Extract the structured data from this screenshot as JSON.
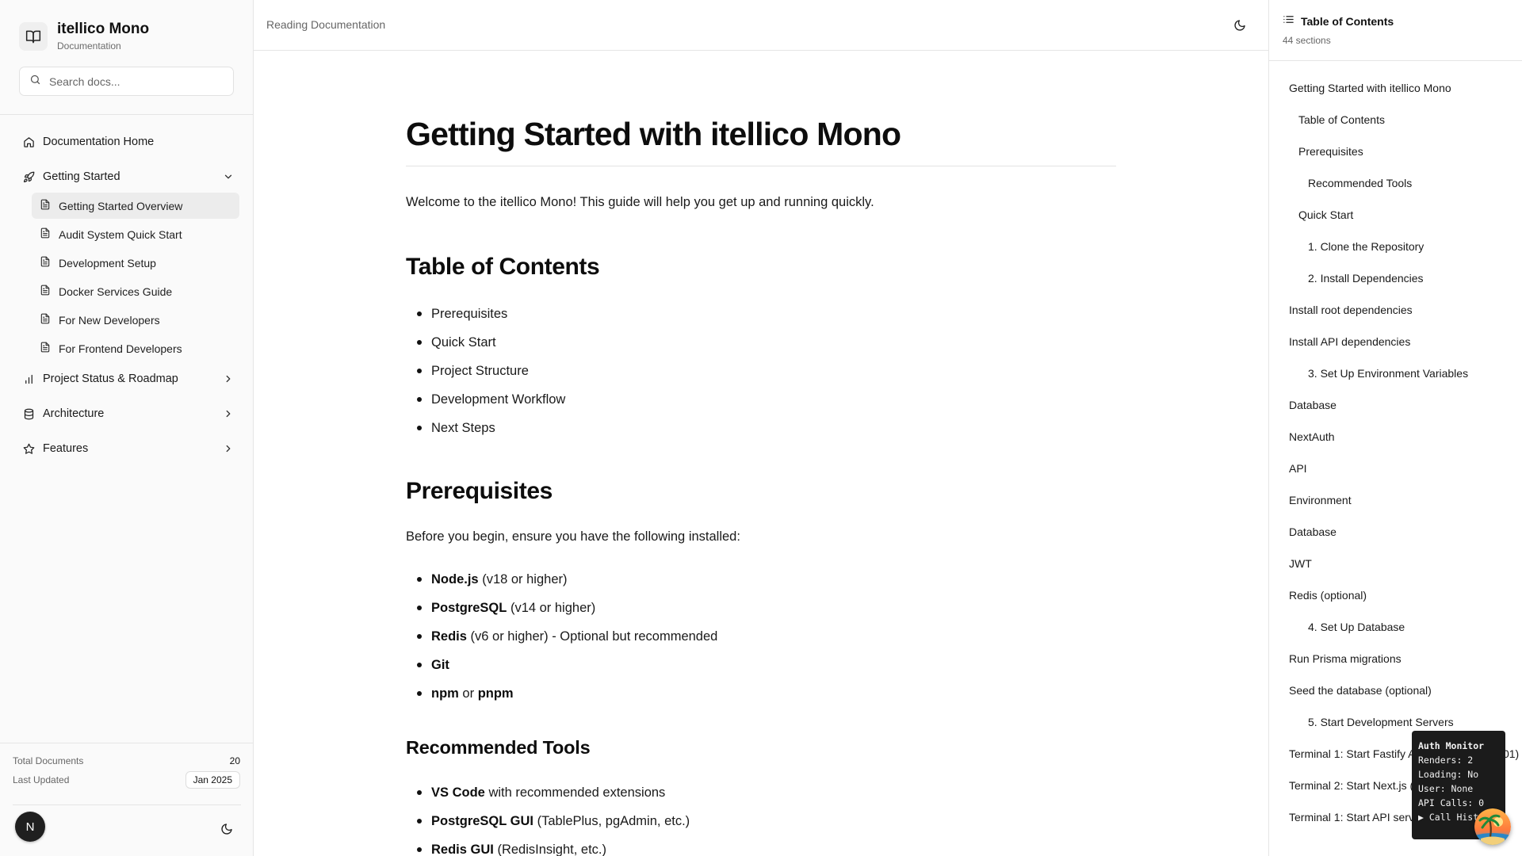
{
  "sidebar": {
    "brand": {
      "name": "itellico Mono",
      "subtitle": "Documentation"
    },
    "search": {
      "placeholder": "Search docs..."
    },
    "nav": {
      "home": "Documentation Home",
      "getting_started": "Getting Started",
      "getting_started_items": [
        "Getting Started Overview",
        "Audit System Quick Start",
        "Development Setup",
        "Docker Services Guide",
        "For New Developers",
        "For Frontend Developers"
      ],
      "project_status": "Project Status & Roadmap",
      "architecture": "Architecture",
      "features": "Features"
    },
    "footer": {
      "total_docs_label": "Total Documents",
      "total_docs_value": "20",
      "last_updated_label": "Last Updated",
      "last_updated_value": "Jan 2025",
      "avatar_initial": "N"
    }
  },
  "header": {
    "title": "Reading Documentation"
  },
  "main": {
    "title": "Getting Started with itellico Mono",
    "intro": "Welcome to the itellico Mono! This guide will help you get up and running quickly.",
    "toc_heading": "Table of Contents",
    "toc_items": [
      "Prerequisites",
      "Quick Start",
      "Project Structure",
      "Development Workflow",
      "Next Steps"
    ],
    "prereq_heading": "Prerequisites",
    "prereq_intro": "Before you begin, ensure you have the following installed:",
    "prereqs": [
      {
        "bold": "Node.js",
        "rest": " (v18 or higher)"
      },
      {
        "bold": "PostgreSQL",
        "rest": " (v14 or higher)"
      },
      {
        "bold": "Redis",
        "rest": " (v6 or higher) - Optional but recommended"
      },
      {
        "bold": "Git",
        "rest": ""
      },
      {
        "bold": "npm",
        "mid": " or ",
        "bold2": "pnpm"
      }
    ],
    "tools_heading": "Recommended Tools",
    "tools": [
      {
        "bold": "VS Code",
        "rest": " with recommended extensions"
      },
      {
        "bold": "PostgreSQL GUI",
        "rest": " (TablePlus, pgAdmin, etc.)"
      },
      {
        "bold": "Redis GUI",
        "rest": " (RedisInsight, etc.)"
      }
    ]
  },
  "toc": {
    "title": "Table of Contents",
    "count": "44 sections",
    "items": [
      {
        "label": "Getting Started with itellico Mono",
        "level": 0
      },
      {
        "label": "Table of Contents",
        "level": 1
      },
      {
        "label": "Prerequisites",
        "level": 1
      },
      {
        "label": "Recommended Tools",
        "level": 2
      },
      {
        "label": "Quick Start",
        "level": 1
      },
      {
        "label": "1. Clone the Repository",
        "level": 2
      },
      {
        "label": "2. Install Dependencies",
        "level": 2
      },
      {
        "label": "Install root dependencies",
        "level": 0
      },
      {
        "label": "Install API dependencies",
        "level": 0
      },
      {
        "label": "3. Set Up Environment Variables",
        "level": 2
      },
      {
        "label": "Database",
        "level": 0
      },
      {
        "label": "NextAuth",
        "level": 0
      },
      {
        "label": "API",
        "level": 0
      },
      {
        "label": "Environment",
        "level": 0
      },
      {
        "label": "Database",
        "level": 0
      },
      {
        "label": "JWT",
        "level": 0
      },
      {
        "label": "Redis (optional)",
        "level": 0
      },
      {
        "label": "4. Set Up Database",
        "level": 2
      },
      {
        "label": "Run Prisma migrations",
        "level": 0
      },
      {
        "label": "Seed the database (optional)",
        "level": 0
      },
      {
        "label": "5. Start Development Servers",
        "level": 2
      },
      {
        "label": "Terminal 1: Start Fastify API Server (port 3001)",
        "level": 0
      },
      {
        "label": "Terminal 2: Start Next.js (port 3000)",
        "level": 0
      },
      {
        "label": "Terminal 1: Start API server",
        "level": 0
      }
    ]
  },
  "auth_monitor": {
    "title": "Auth Monitor",
    "renders": "Renders: 2",
    "loading": "Loading: No",
    "user": "User: None",
    "api_calls": "API Calls: 0",
    "call_history": "▶ Call History"
  }
}
